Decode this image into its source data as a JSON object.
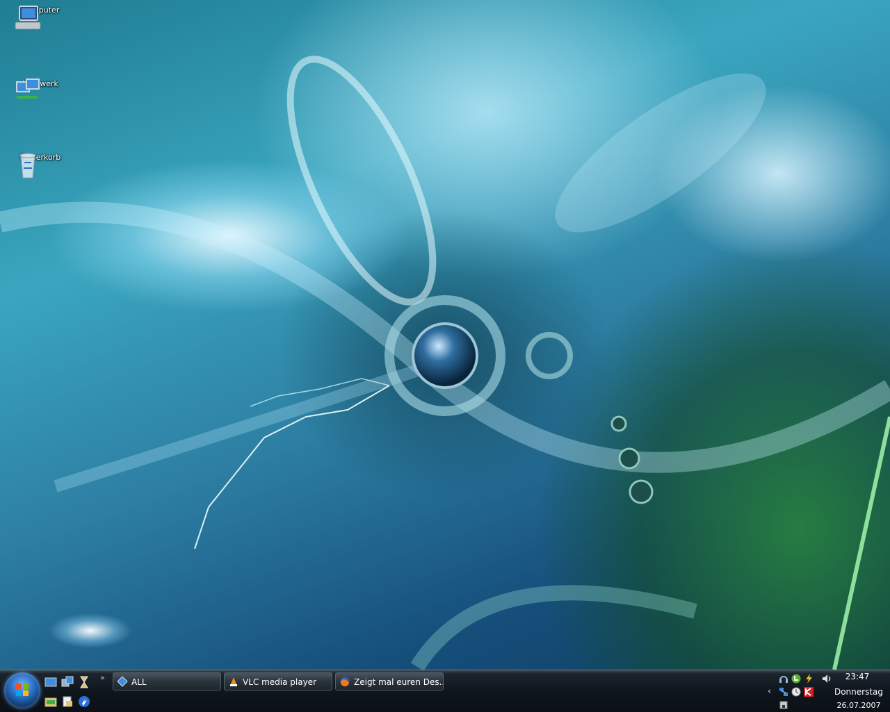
{
  "desktop_icons": [
    {
      "label": "Computer",
      "icon": "computer-icon"
    },
    {
      "label": "Netzwerk",
      "icon": "network-icon"
    },
    {
      "label": "Papierkorb",
      "icon": "recycle-bin-icon"
    }
  ],
  "taskbar": {
    "overflow_chevron": "»",
    "tasks": [
      {
        "label": "ALL",
        "icon": "app-diamond-icon"
      },
      {
        "label": "VLC media player",
        "icon": "vlc-icon"
      },
      {
        "label": "Zeigt mal euren Des...",
        "icon": "firefox-icon"
      }
    ],
    "tray_chevron": "‹",
    "clock": {
      "time": "23:47",
      "day": "Donnerstag",
      "date": "26.07.2007"
    }
  },
  "colors": {
    "taskbar": "#0f161d",
    "accent": "#2468b8"
  }
}
